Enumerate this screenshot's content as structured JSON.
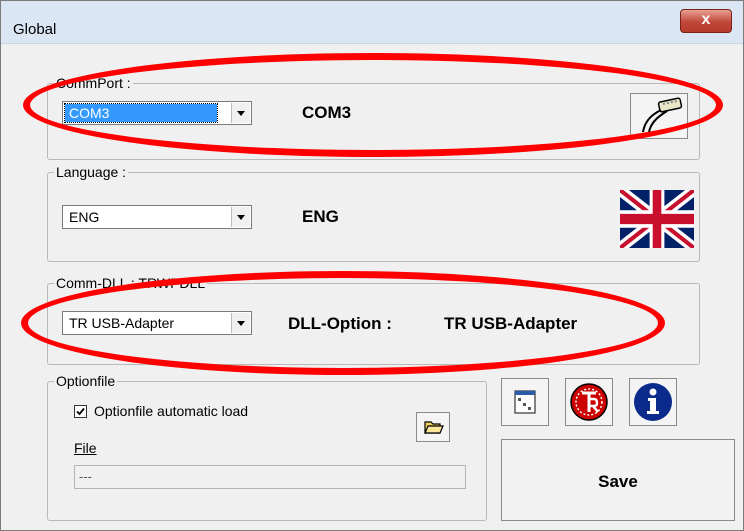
{
  "window": {
    "title": "Global",
    "close_label": "x"
  },
  "comm_port": {
    "legend": "CommPort :",
    "selected": "COM3",
    "display": "COM3",
    "icon": "serial-cable-icon"
  },
  "language": {
    "legend": "Language :",
    "selected": "ENG",
    "display": "ENG",
    "icon": "uk-flag-icon"
  },
  "comm_dll": {
    "legend": "Comm-DLL : TRWPDLL",
    "selected": "TR USB-Adapter",
    "option_label": "DLL-Option :",
    "option_value": "TR USB-Adapter"
  },
  "optionfile": {
    "legend": "Optionfile",
    "checkbox_label": "Optionfile automatic load",
    "checked": true,
    "file_label": "File",
    "file_value": "---"
  },
  "buttons": {
    "save_label": "Save",
    "settings_icon": "window-settings-icon",
    "brand_icon": "tr-logo-icon",
    "info_icon": "info-icon",
    "folder_icon": "folder-open-icon"
  },
  "colors": {
    "annotation": "#ff0000",
    "info": "#0a2a8c",
    "brand": "#cc0000"
  }
}
